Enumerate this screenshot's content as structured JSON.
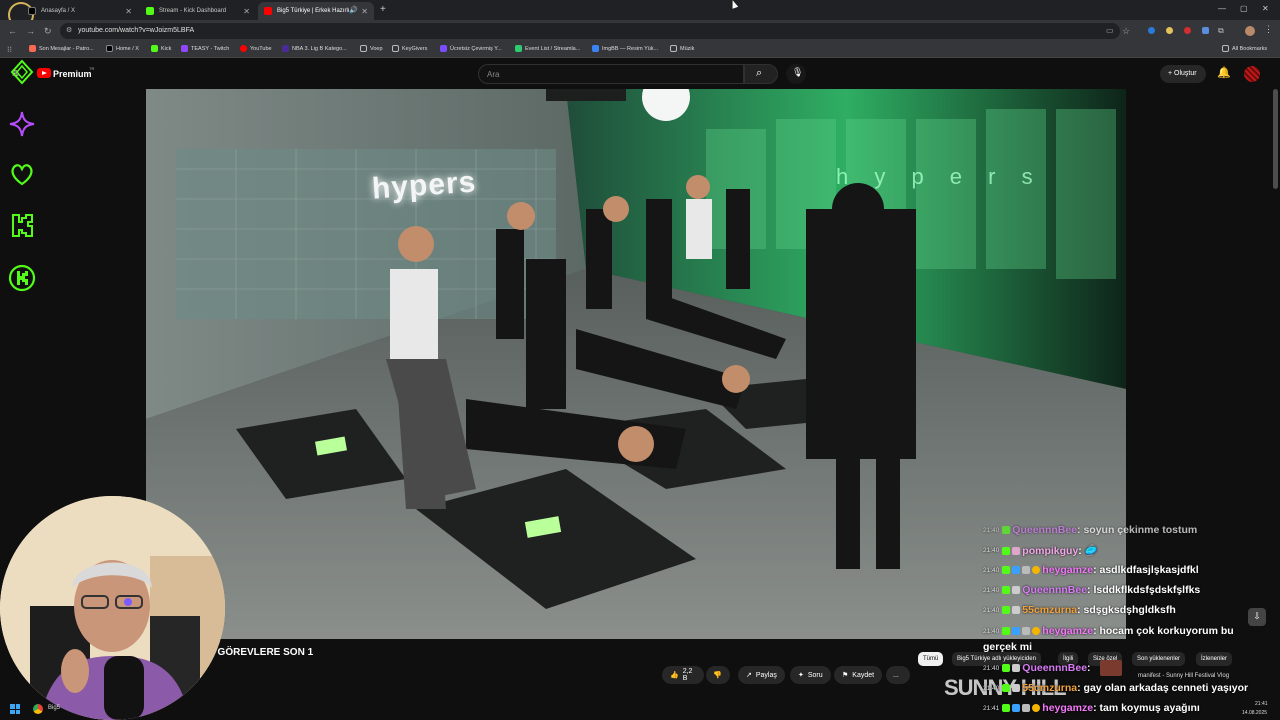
{
  "browser": {
    "tabs": [
      {
        "title": "Anasayfa / X",
        "active": false
      },
      {
        "title": "Stream - Kick Dashboard",
        "active": false
      },
      {
        "title": "Big5 Türkiye | Erkek Hazırlı",
        "active": true
      }
    ],
    "url": "youtube.com/watch?v=wJoizm5LBFA",
    "bookmarks": [
      "Son Mesajlar - Patro...",
      "Home / X",
      "Kick",
      "TEASY - Twitch",
      "YouTube",
      "NBA 3. Lig B Katego...",
      "Voep",
      "KeyGivers",
      "Ücretsiz Çevirmiş Y...",
      "Event List / Streamla...",
      "ImgBB — Resim Yük...",
      "Müzik"
    ],
    "all_bookmarks": "All Bookmarks"
  },
  "youtube": {
    "logo_text": "Premium",
    "logo_sup": "TR",
    "search_placeholder": "Ara",
    "create_label": "+ Oluştur"
  },
  "video": {
    "wall_text": "hypers",
    "title_partial": ". GÖREVLERE SON 1"
  },
  "actions": {
    "like_count": "2,2 B",
    "share": "Paylaş",
    "ask": "Soru",
    "save": "Kaydet",
    "more": "..."
  },
  "chips": [
    {
      "label": "Tümü",
      "active": true
    },
    {
      "label": "Big5 Türkiye adlı yükleyiciden",
      "active": false
    },
    {
      "label": "İlgili",
      "active": false
    },
    {
      "label": "Size özel",
      "active": false
    },
    {
      "label": "Son yüklenenler",
      "active": false
    },
    {
      "label": "İzlenenler",
      "active": false
    }
  ],
  "chat": [
    {
      "time": "21:40",
      "user": "QueennnBee",
      "color": "#d77cf5",
      "msg": ": soyun çekinme tostum"
    },
    {
      "time": "21:40",
      "user": "pompikguy",
      "color": "#f3a8e9",
      "msg": ": 🥏"
    },
    {
      "time": "21:40",
      "user": "heygamze",
      "color": "#f478f9",
      "msg": ": asdlkdfasjlşkasjdfkl"
    },
    {
      "time": "21:40",
      "user": "QueennnBee",
      "color": "#d77cf5",
      "msg": ": lsddkflkdsfşdskfşlfks"
    },
    {
      "time": "21:40",
      "user": "55cmzurna",
      "color": "#f2a23c",
      "msg": ": sdşgksdşhgldksfh"
    },
    {
      "time": "21:40",
      "user": "heygamze",
      "color": "#f478f9",
      "msg": ": hocam çok korkuyorum bu"
    },
    {
      "time": "",
      "user": "",
      "color": "#ffffff",
      "msg": "gerçek mi"
    },
    {
      "time": "21:40",
      "user": "QueennnBee",
      "color": "#d77cf5",
      "msg": ":"
    },
    {
      "time": "21:40",
      "user": "55cmzurna",
      "color": "#f2a23c",
      "msg": ": gay olan arkadaş cenneti yaşıyor"
    },
    {
      "time": "21:41",
      "user": "heygamze",
      "color": "#f478f9",
      "msg": ": tam koymuş ayağını"
    }
  ],
  "overlay": {
    "sunny_text": "SUNNY HILL",
    "manifest_line": "manifest - Sunny Hill Festival Vlog"
  },
  "taskbar": {
    "app_label": "Big5",
    "time": "21:41",
    "date": "14.08.2025"
  }
}
